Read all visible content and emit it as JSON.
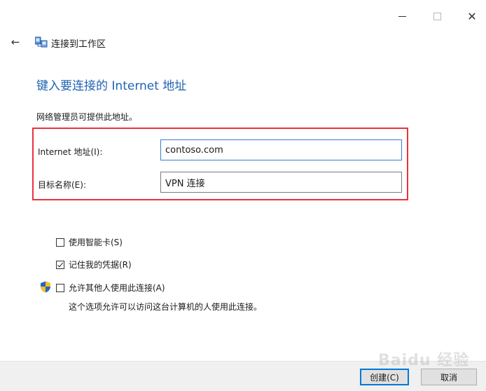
{
  "window": {
    "caption_buttons": {
      "minimize_icon": "minimize-icon",
      "maximize_icon": "maximize-icon",
      "close_icon": "close-icon",
      "close_glyph": "✕"
    }
  },
  "nav": {
    "back_glyph": "←",
    "title": "连接到工作区"
  },
  "main": {
    "heading": "键入要连接的 Internet 地址",
    "subtext": "网络管理员可提供此地址。",
    "fields": {
      "internet_address": {
        "label": "Internet 地址(I):",
        "value": "contoso.com"
      },
      "destination_name": {
        "label": "目标名称(E):",
        "value": "VPN 连接"
      }
    },
    "options": {
      "smart_card": {
        "label": "使用智能卡(S)",
        "checked": false
      },
      "remember_credentials": {
        "label": "记住我的凭据(R)",
        "checked": true
      },
      "allow_others": {
        "label": "允许其他人使用此连接(A)",
        "checked": false,
        "description": "这个选项允许可以访问这台计算机的人使用此连接。"
      }
    }
  },
  "footer": {
    "create_label": "创建(C)",
    "cancel_label": "取消"
  },
  "watermark": "Baidu 经验",
  "colors": {
    "heading": "#1f63b3",
    "highlight_border": "#e8323c",
    "focus_border": "#3b7bd2",
    "default_button_border": "#0078d7",
    "footer_bg": "#f0f0f0"
  }
}
